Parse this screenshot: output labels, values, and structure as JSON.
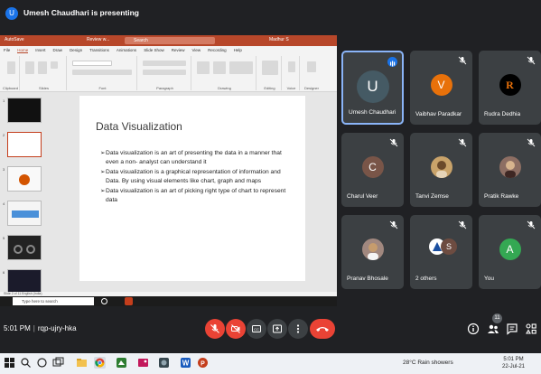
{
  "meet": {
    "presenter_initial": "U",
    "presenting_text": "Umesh Chaudhari is presenting",
    "time": "5:01 PM",
    "meeting_code": "rqp-ujry-hka",
    "participant_count": "11"
  },
  "powerpoint": {
    "autosave": "AutoSave",
    "file_name": "Review w...",
    "search_placeholder": "Search",
    "user": "Madhur S",
    "tabs": [
      "File",
      "Home",
      "Insert",
      "Draw",
      "Design",
      "Transitions",
      "Animations",
      "Slide Show",
      "Review",
      "View",
      "Recording",
      "Help"
    ],
    "active_tab": "Home",
    "ribbon_groups": [
      "Clipboard",
      "Slides",
      "Font",
      "Paragraph",
      "Drawing",
      "Editing",
      "Voice",
      "Designer"
    ],
    "status": "Slide 2 of 11   English (India)",
    "taskbar_search": "Type here to search"
  },
  "slide": {
    "title": "Data Visualization",
    "bullets": [
      "Data visualization is an art of presenting the data in a manner that even a non- analyst can understand it",
      "Data visualization is a graphical representation of information and Data. By using visual elements like chart, graph and maps",
      "Data visualization is an art of picking right type of chart to represent data"
    ]
  },
  "participants": [
    {
      "name": "Umesh Chaudhari",
      "initial": "U",
      "color": "#455a64",
      "speaking": true
    },
    {
      "name": "Vaibhav Paradkar",
      "initial": "V",
      "color": "#e8710a",
      "speaking": false
    },
    {
      "name": "Rudra Dedhia",
      "initial": "R",
      "color": "#000000",
      "speaking": false
    },
    {
      "name": "Charul Veer",
      "initial": "C",
      "color": "#795548",
      "speaking": false
    },
    {
      "name": "Tanvi Zemse",
      "initial": "",
      "color": "#c9a36a",
      "speaking": false
    },
    {
      "name": "Pratik Rawke",
      "initial": "",
      "color": "#8d6e63",
      "speaking": false
    },
    {
      "name": "Pranav Bhosale",
      "initial": "",
      "color": "#a1887f",
      "speaking": false
    },
    {
      "name": "2 others",
      "initial": "S",
      "color": "#6d4c41",
      "speaking": false
    },
    {
      "name": "You",
      "initial": "A",
      "color": "#34a853",
      "speaking": false
    }
  ],
  "windows": {
    "weather": "28°C  Rain showers",
    "clock_time": "5:01 PM",
    "clock_date": "22-Jul-21"
  },
  "colors": {
    "meet_bg": "#202124",
    "tile_bg": "#3c4043",
    "ppt_accent": "#b7472a",
    "danger": "#ea4335",
    "speaking_border": "#8ab4f8"
  }
}
